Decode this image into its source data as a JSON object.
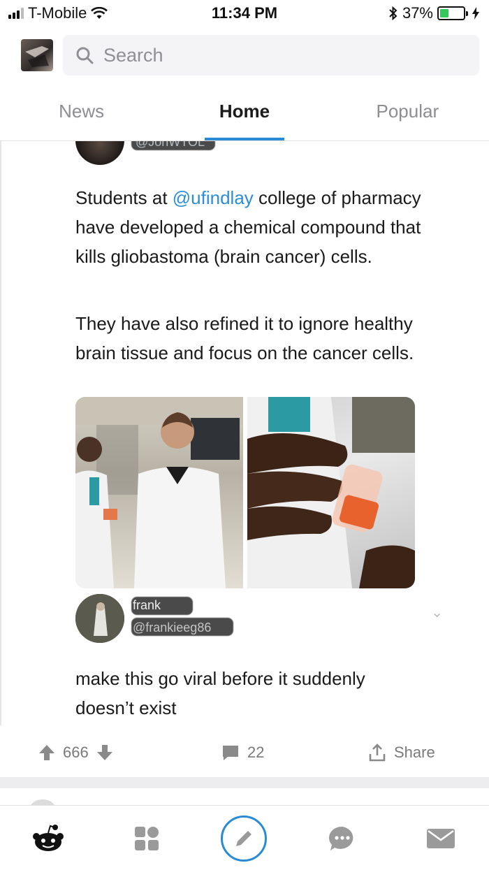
{
  "status_bar": {
    "carrier": "T-Mobile",
    "time": "11:34 PM",
    "battery_percent": "37%",
    "battery_level": 0.37
  },
  "search": {
    "placeholder": "Search"
  },
  "tabs": [
    {
      "label": "News",
      "active": false
    },
    {
      "label": "Home",
      "active": true
    },
    {
      "label": "Popular",
      "active": false
    }
  ],
  "tweet": {
    "handle_partial": "@JonWTOL",
    "text_part1": "Students at ",
    "mention": "@ufindlay",
    "text_part2": " college of pharmacy have developed a chemical compound that kills gliobastoma (brain cancer) cells.",
    "text_para2": "They have also refined it to ignore healthy brain tissue and focus on the cancer cells."
  },
  "reply": {
    "name": "frank",
    "handle": "@frankieeg86",
    "text": "make this go viral before it suddenly doesn’t exist"
  },
  "actions": {
    "upvotes": "666",
    "comments": "22",
    "share_label": "Share"
  },
  "colors": {
    "accent": "#2a8ad4",
    "mention": "#2b8fd6",
    "battery": "#35c759"
  }
}
